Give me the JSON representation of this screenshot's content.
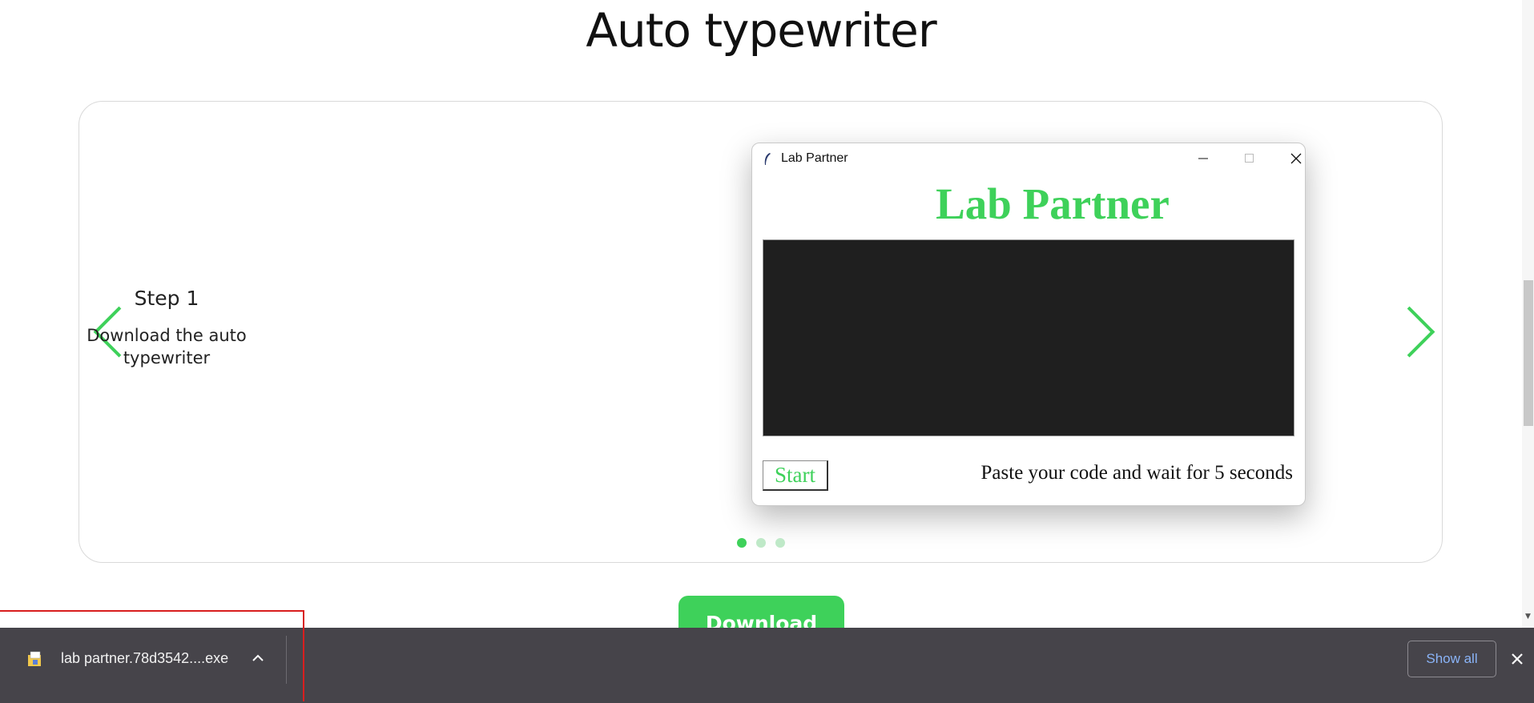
{
  "page": {
    "title": "Auto typewriter"
  },
  "carousel": {
    "step_title": "Step 1",
    "step_description": "Download the auto typewriter",
    "prev_icon": "chevron-left-icon",
    "next_icon": "chevron-right-icon",
    "slide_count": 3,
    "active_slide": 1
  },
  "app_window": {
    "title": "Lab Partner",
    "heading": "Lab Partner",
    "start_label": "Start",
    "status_text": "Paste your code and wait for 5 seconds",
    "colors": {
      "accent": "#3ed15a",
      "code_bg": "#1f1f1f"
    }
  },
  "download_button": {
    "label": "Download"
  },
  "download_bar": {
    "file_name": "lab partner.78d3542....exe",
    "show_all_label": "Show all",
    "colors": {
      "background": "#46444a",
      "link": "#8ab4f8"
    }
  }
}
